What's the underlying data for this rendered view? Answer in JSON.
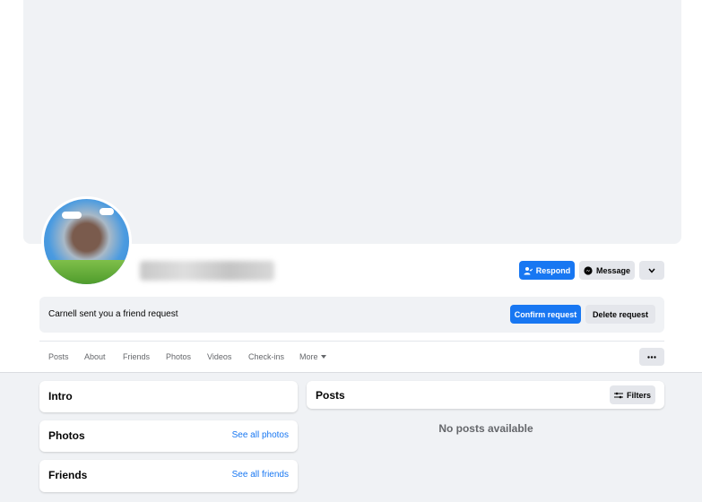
{
  "profile": {
    "respond_label": "Respond",
    "message_label": "Message"
  },
  "friend_request": {
    "text": "Carnell sent you a friend request",
    "confirm_label": "Confirm request",
    "delete_label": "Delete request"
  },
  "tabs": [
    "Posts",
    "About",
    "Friends",
    "Photos",
    "Videos",
    "Check-ins",
    "More"
  ],
  "intro": {
    "title": "Intro"
  },
  "photos": {
    "title": "Photos",
    "link": "See all photos"
  },
  "friends": {
    "title": "Friends",
    "link": "See all friends"
  },
  "posts": {
    "title": "Posts",
    "filters_label": "Filters",
    "empty_text": "No posts available"
  },
  "colors": {
    "accent": "#1877f2",
    "secondary_button": "#e4e6eb",
    "page_bg": "#f0f2f5"
  }
}
